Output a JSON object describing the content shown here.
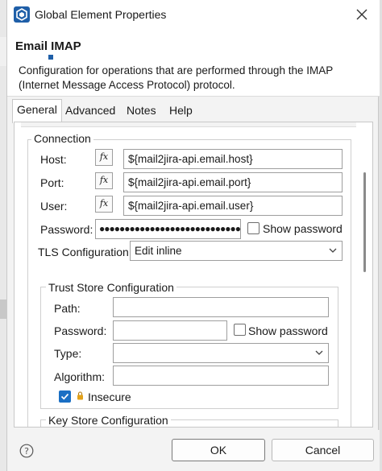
{
  "window": {
    "title": "Global Element Properties"
  },
  "header": {
    "title": "Email IMAP",
    "description": "Configuration for operations that are performed through the IMAP (Internet Message Access Protocol) protocol."
  },
  "tabs": [
    {
      "label": "General",
      "active": true
    },
    {
      "label": "Advanced",
      "active": false
    },
    {
      "label": "Notes",
      "active": false
    },
    {
      "label": "Help",
      "active": false
    }
  ],
  "connection": {
    "group_label": "Connection",
    "host": {
      "label": "Host:",
      "value": "${mail2jira-api.email.host}"
    },
    "port": {
      "label": "Port:",
      "value": "${mail2jira-api.email.port}"
    },
    "user": {
      "label": "User:",
      "value": "${mail2jira-api.email.user}"
    },
    "password": {
      "label": "Password:",
      "value": "●●●●●●●●●●●●●●●●●●●●●●●●●●●●●",
      "show_label": "Show password"
    },
    "fx_label": "fx",
    "tls": {
      "label": "TLS Configuration",
      "value": "Edit inline"
    }
  },
  "trust_store": {
    "group_label": "Trust Store Configuration",
    "path": {
      "label": "Path:",
      "value": ""
    },
    "password": {
      "label": "Password:",
      "value": "",
      "show_label": "Show password"
    },
    "type": {
      "label": "Type:",
      "value": ""
    },
    "algorithm": {
      "label": "Algorithm:",
      "value": ""
    },
    "insecure": {
      "label": "Insecure",
      "checked": true
    }
  },
  "key_store": {
    "group_label": "Key Store Configuration"
  },
  "footer": {
    "ok_label": "OK",
    "cancel_label": "Cancel",
    "help_label": "?"
  },
  "colors": {
    "accent": "#1a6fc4",
    "app_icon": "#1f5fa8"
  }
}
